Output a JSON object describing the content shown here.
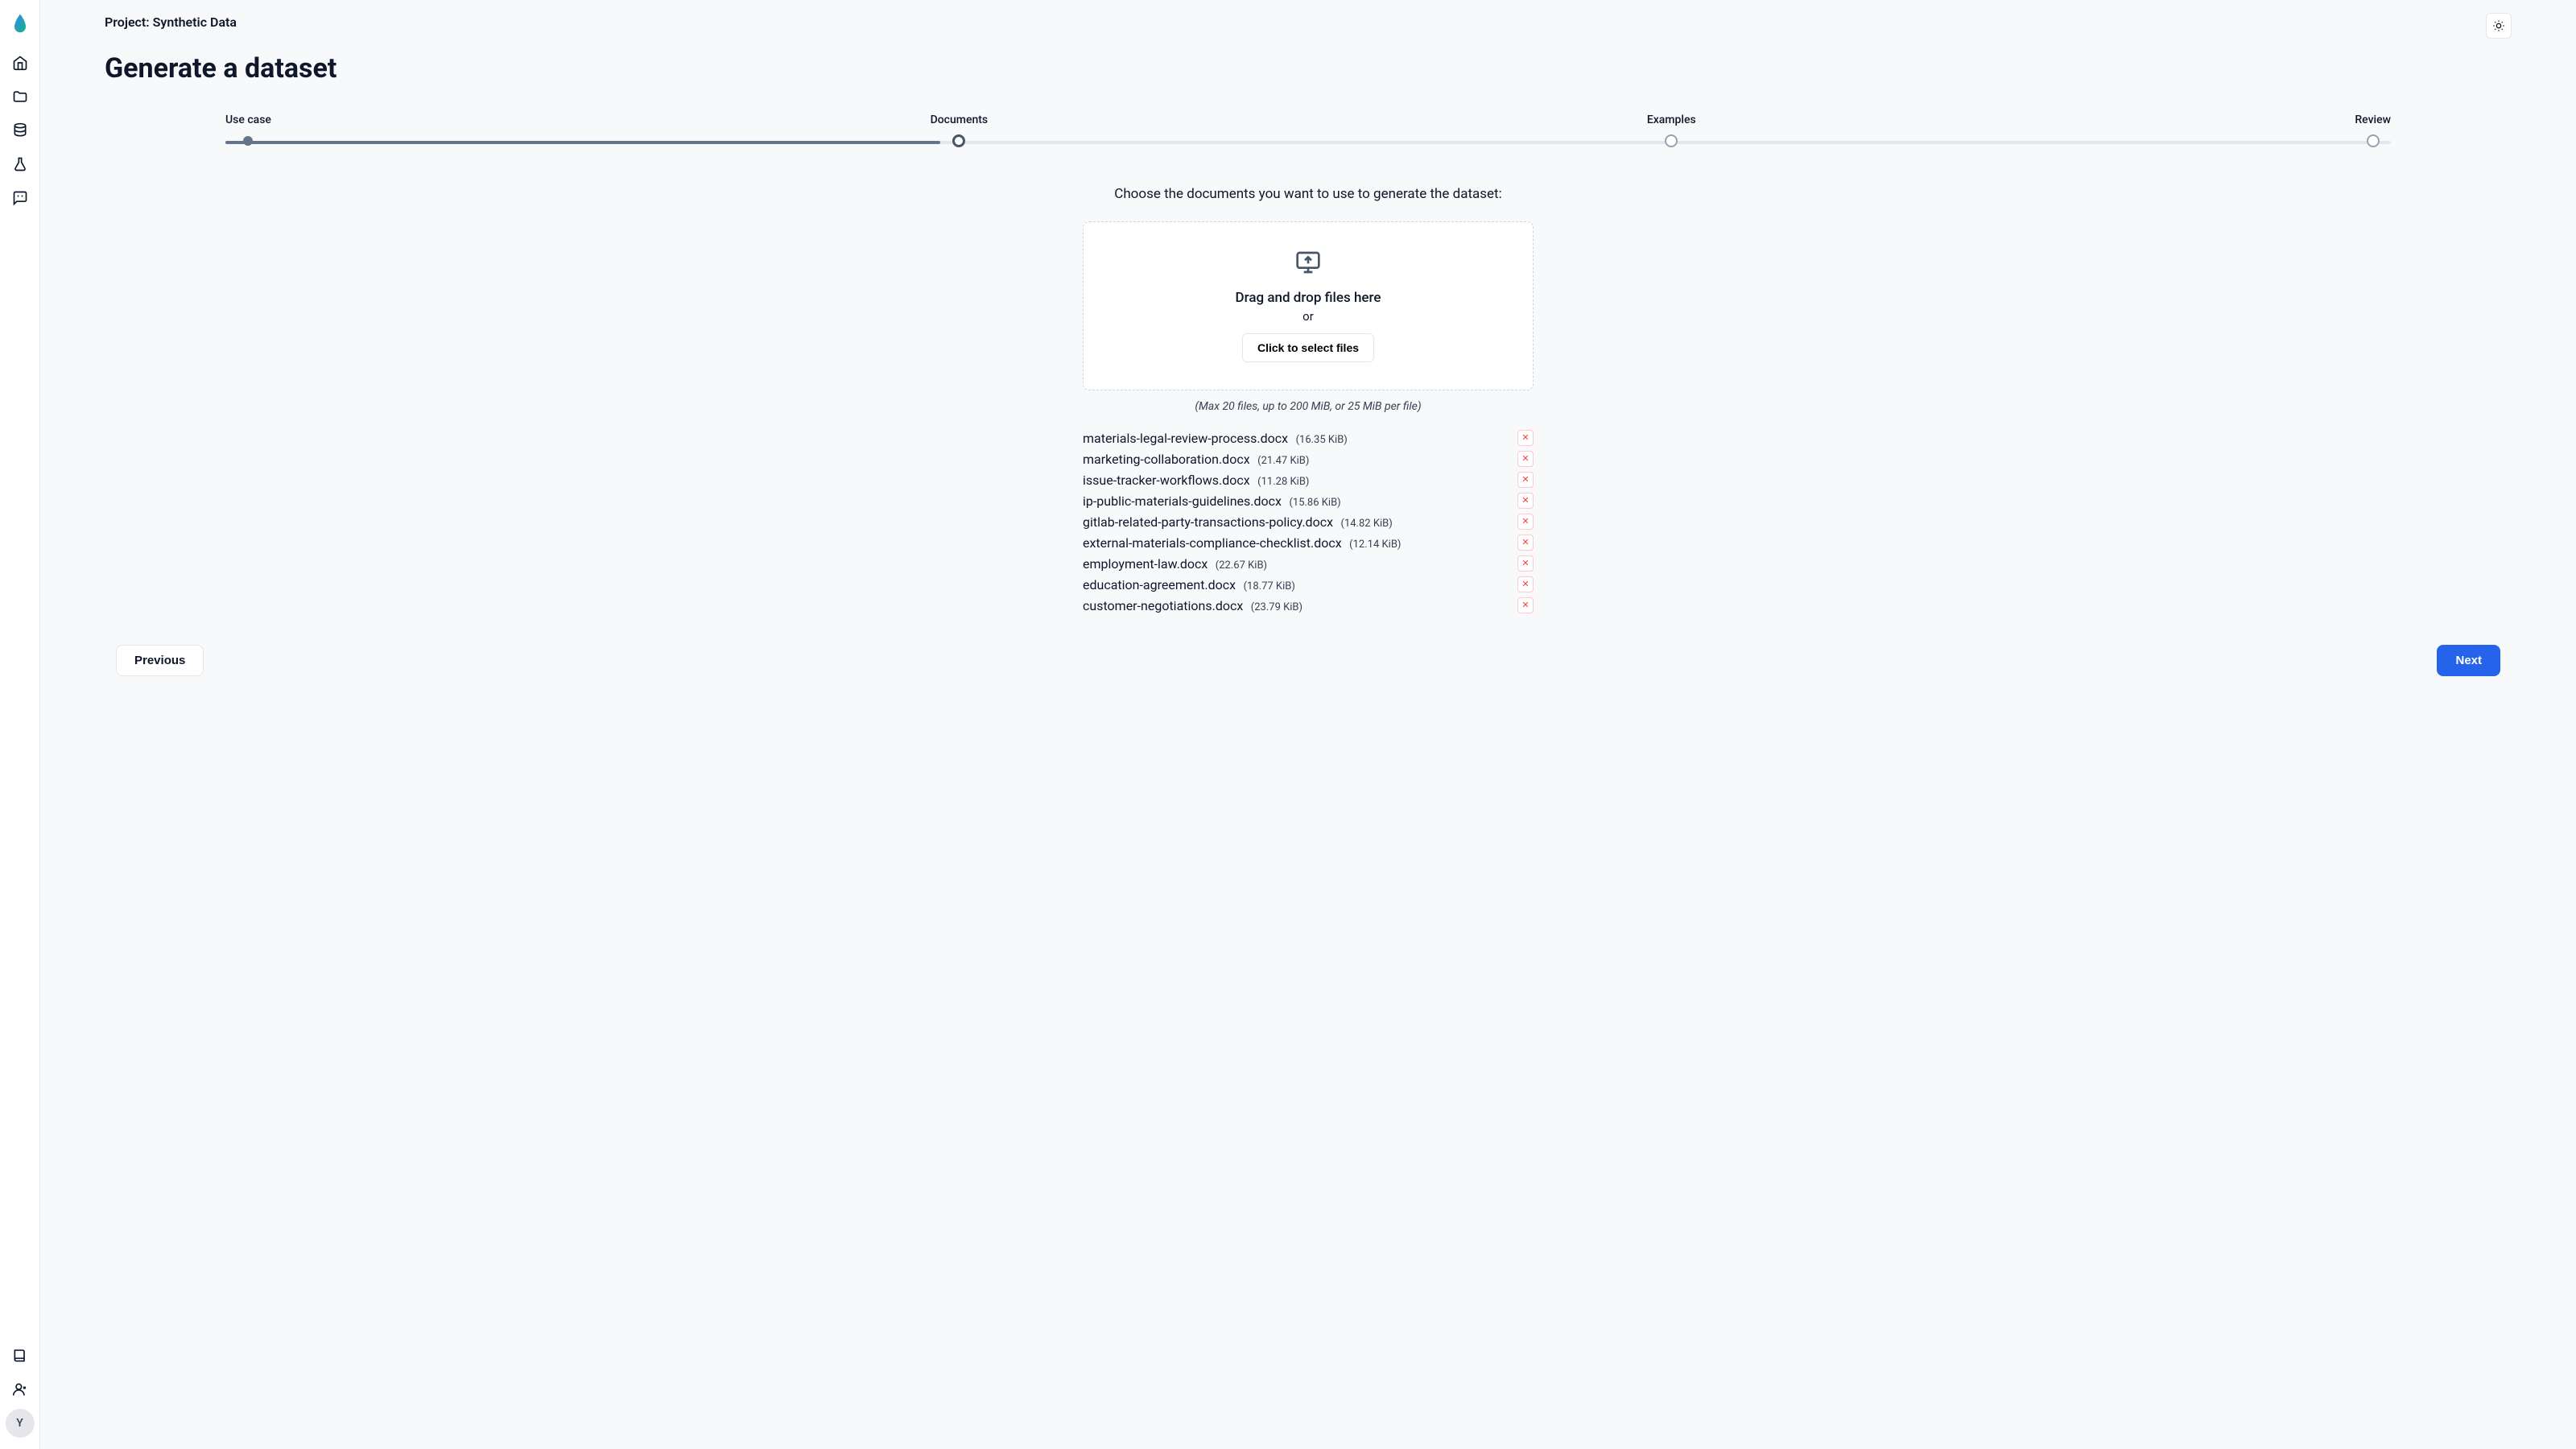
{
  "header": {
    "breadcrumb": "Project: Synthetic Data",
    "title": "Generate a dataset"
  },
  "sidebar": {
    "avatar_initial": "Y"
  },
  "stepper": {
    "steps": [
      {
        "label": "Use case",
        "state": "completed"
      },
      {
        "label": "Documents",
        "state": "active"
      },
      {
        "label": "Examples",
        "state": "pending"
      },
      {
        "label": "Review",
        "state": "pending"
      }
    ]
  },
  "documents": {
    "instruction": "Choose the documents you want to use to generate the dataset:",
    "dropzone": {
      "drag_text": "Drag and drop files here",
      "or_text": "or",
      "button_label": "Click to select files"
    },
    "hint": "(Max 20 files, up to 200 MiB, or 25 MiB per file)",
    "files": [
      {
        "name": "materials-legal-review-process.docx",
        "size": "(16.35 KiB)"
      },
      {
        "name": "marketing-collaboration.docx",
        "size": "(21.47 KiB)"
      },
      {
        "name": "issue-tracker-workflows.docx",
        "size": "(11.28 KiB)"
      },
      {
        "name": "ip-public-materials-guidelines.docx",
        "size": "(15.86 KiB)"
      },
      {
        "name": "gitlab-related-party-transactions-policy.docx",
        "size": "(14.82 KiB)"
      },
      {
        "name": "external-materials-compliance-checklist.docx",
        "size": "(12.14 KiB)"
      },
      {
        "name": "employment-law.docx",
        "size": "(22.67 KiB)"
      },
      {
        "name": "education-agreement.docx",
        "size": "(18.77 KiB)"
      },
      {
        "name": "customer-negotiations.docx",
        "size": "(23.79 KiB)"
      }
    ]
  },
  "footer": {
    "previous_label": "Previous",
    "next_label": "Next"
  }
}
